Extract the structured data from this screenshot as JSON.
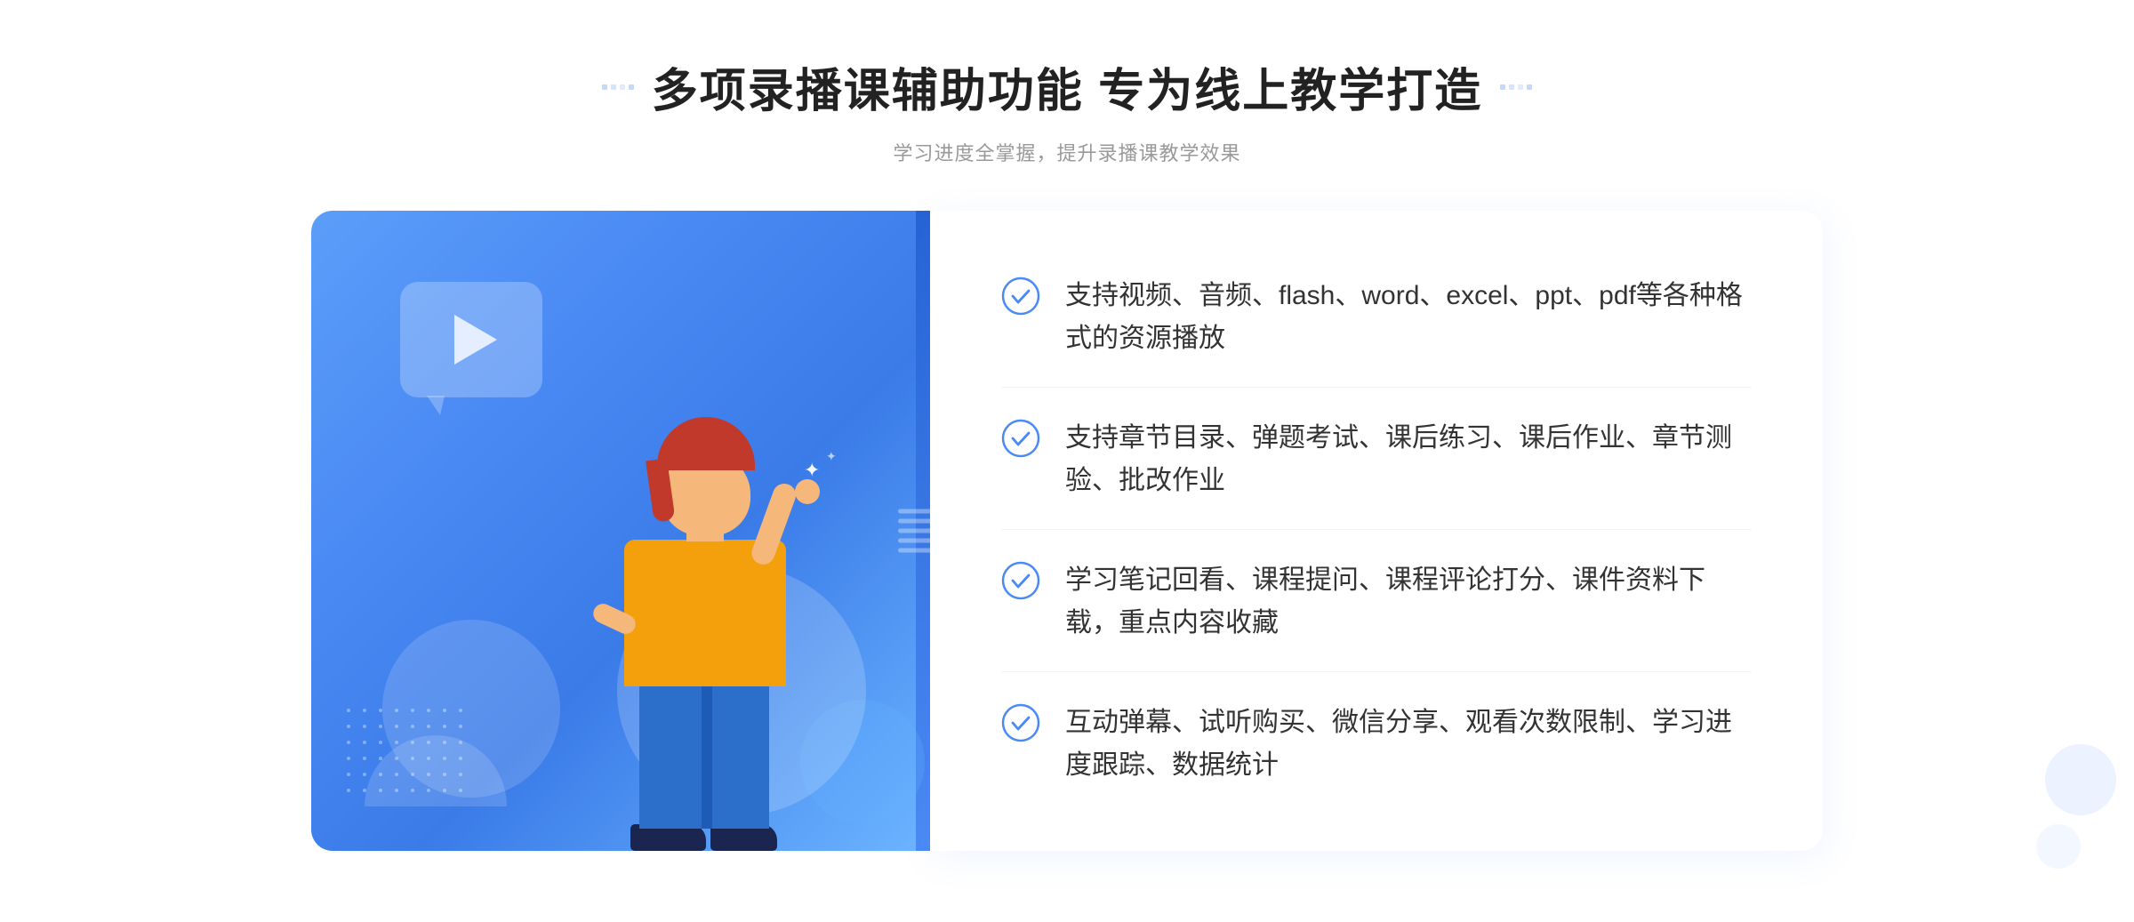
{
  "header": {
    "title": "多项录播课辅助功能 专为线上教学打造",
    "subtitle": "学习进度全掌握，提升录播课教学效果"
  },
  "features": [
    {
      "id": 1,
      "text": "支持视频、音频、flash、word、excel、ppt、pdf等各种格式的资源播放"
    },
    {
      "id": 2,
      "text": "支持章节目录、弹题考试、课后练习、课后作业、章节测验、批改作业"
    },
    {
      "id": 3,
      "text": "学习笔记回看、课程提问、课程评论打分、课件资料下载，重点内容收藏"
    },
    {
      "id": 4,
      "text": "互动弹幕、试听购买、微信分享、观看次数限制、学习进度跟踪、数据统计"
    }
  ],
  "colors": {
    "accent": "#4a8af4",
    "accent_dark": "#2563d4",
    "title_color": "#222222",
    "subtitle_color": "#999999",
    "feature_text_color": "#333333",
    "check_color": "#4a8af4",
    "divider_color": "#f0f4ff"
  }
}
